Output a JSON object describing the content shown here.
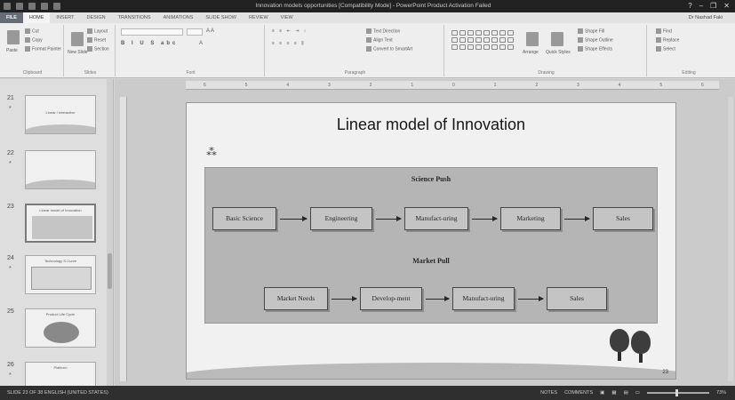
{
  "window": {
    "title": "Innovation models opportunities [Compatibility Mode] - PowerPoint Product Activation Failed",
    "user": "Dr Nashad Faki"
  },
  "ribbon": {
    "tabs": [
      "FILE",
      "HOME",
      "INSERT",
      "DESIGN",
      "TRANSITIONS",
      "ANIMATIONS",
      "SLIDE SHOW",
      "REVIEW",
      "VIEW"
    ],
    "active_tab": "HOME",
    "clipboard": {
      "paste": "Paste",
      "cut": "Cut",
      "copy": "Copy",
      "format_painter": "Format Painter",
      "label": "Clipboard"
    },
    "slides": {
      "new_slide": "New Slide",
      "layout": "Layout",
      "reset": "Reset",
      "section": "Section",
      "label": "Slides"
    },
    "font": {
      "label": "Font"
    },
    "paragraph": {
      "text_direction": "Text Direction",
      "align_text": "Align Text",
      "convert_smartart": "Convert to SmartArt",
      "label": "Paragraph"
    },
    "drawing": {
      "arrange": "Arrange",
      "quick_styles": "Quick Styles",
      "shape_fill": "Shape Fill",
      "shape_outline": "Shape Outline",
      "shape_effects": "Shape Effects",
      "label": "Drawing"
    },
    "editing": {
      "find": "Find",
      "replace": "Replace",
      "select": "Select",
      "label": "Editing"
    }
  },
  "thumbnails": [
    {
      "num": "21",
      "star": "*",
      "title": "Linear / Interactive"
    },
    {
      "num": "22",
      "star": "*",
      "title": ""
    },
    {
      "num": "23",
      "star": "",
      "title": "Linear model of Innovation",
      "selected": true
    },
    {
      "num": "24",
      "star": "*",
      "title": "Technology S-Curve"
    },
    {
      "num": "25",
      "star": "",
      "title": "Product Life Cycle"
    },
    {
      "num": "26",
      "star": "*",
      "title": "Platform"
    }
  ],
  "ruler_ticks": [
    "6",
    "5",
    "4",
    "3",
    "2",
    "1",
    "0",
    "1",
    "2",
    "3",
    "4",
    "5",
    "6"
  ],
  "slide": {
    "title": "Linear model of Innovation",
    "science_push": {
      "heading": "Science Push",
      "steps": [
        "Basic Science",
        "Engineering",
        "Manufact-uring",
        "Marketing",
        "Sales"
      ]
    },
    "market_pull": {
      "heading": "Market Pull",
      "steps": [
        "Market Needs",
        "Develop-ment",
        "Manufact-uring",
        "Sales"
      ]
    },
    "number": "23"
  },
  "status": {
    "left": "SLIDE 23 OF 38    ENGLISH (UNITED STATES)",
    "notes": "NOTES",
    "comments": "COMMENTS",
    "zoom": "73%"
  }
}
